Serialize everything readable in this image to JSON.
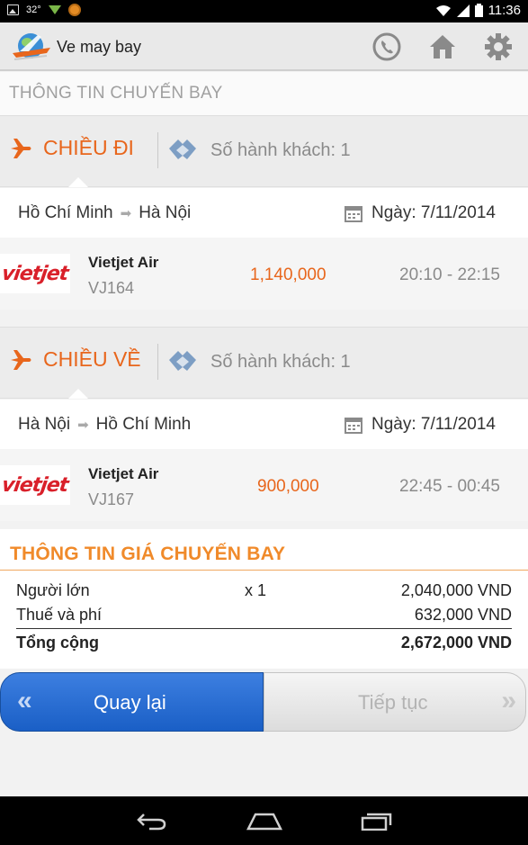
{
  "status_bar": {
    "temperature": "32°",
    "time": "11:36"
  },
  "app_bar": {
    "title": "Ve may bay"
  },
  "section_title": "THÔNG TIN CHUYẾN BAY",
  "outbound": {
    "direction": "CHIỀU ĐI",
    "passengers": "Số hành khách: 1",
    "from": "Hồ Chí Minh",
    "to": "Hà Nội",
    "date": "Ngày: 7/11/2014",
    "airline_logo": "vietjet",
    "airline": "Vietjet Air",
    "code": "VJ164",
    "price": "1,140,000",
    "time": "20:10 - 22:15"
  },
  "inbound": {
    "direction": "CHIỀU VỀ",
    "passengers": "Số hành khách: 1",
    "from": "Hà Nội",
    "to": "Hồ Chí Minh",
    "date": "Ngày: 7/11/2014",
    "airline_logo": "vietjet",
    "airline": "Vietjet Air",
    "code": "VJ167",
    "price": "900,000",
    "time": "22:45 - 00:45"
  },
  "price_info": {
    "title": "THÔNG TIN GIÁ CHUYẾN BAY",
    "rows": [
      {
        "label": "Người lớn",
        "qty": "x 1",
        "amount": "2,040,000 VND"
      },
      {
        "label": "Thuế và phí",
        "qty": "",
        "amount": "632,000 VND"
      },
      {
        "label": "Tổng cộng",
        "qty": "",
        "amount": "2,672,000 VND"
      }
    ]
  },
  "buttons": {
    "back": "Quay lại",
    "next": "Tiếp tục"
  },
  "colors": {
    "accent": "#e8661c",
    "price_title": "#f08a2a",
    "back_button": "#2a6fd6"
  }
}
